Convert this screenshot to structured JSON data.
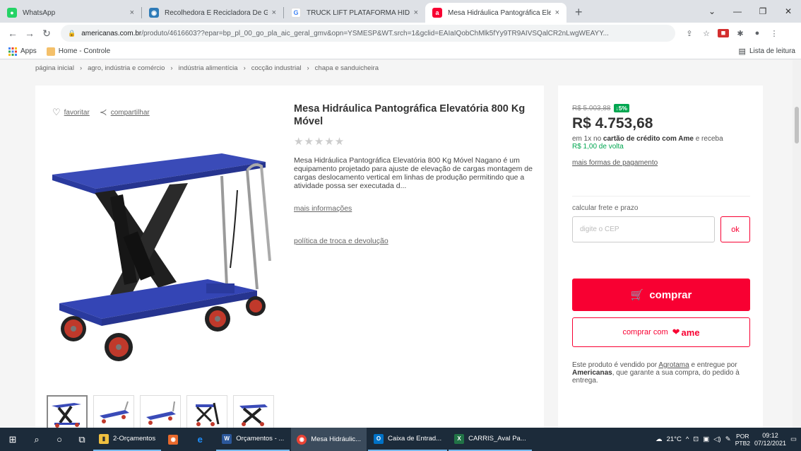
{
  "browser": {
    "tabs": [
      {
        "title": "WhatsApp",
        "color": "#25d366",
        "glyph": "●",
        "active": false
      },
      {
        "title": "Recolhedora E Recicladora De Ga",
        "color": "#2e7bb8",
        "glyph": "◉",
        "active": false
      },
      {
        "title": "TRUCK LIFT PLATAFORMA HIDR/",
        "color": "#4285f4",
        "glyph": "G",
        "active": false
      },
      {
        "title": "Mesa Hidráulica Pantográfica Ele",
        "color": "#f80032",
        "glyph": "a",
        "active": true
      }
    ],
    "new_tab": "+",
    "url_host": "americanas.com.br",
    "url_path": "/produto/4616603??epar=bp_pl_00_go_pla_aic_geral_gmv&opn=YSMESP&WT.srch=1&gclid=EAIaIQobChMlk5fYy9TR9AIVSQalCR2nLwgWEAYY...",
    "bookmarks": [
      {
        "label": "Apps"
      },
      {
        "label": "Home - Controle"
      }
    ],
    "reading_list": "Lista de leitura"
  },
  "page": {
    "breadcrumb": [
      "página inicial",
      "agro, indústria e comércio",
      "indústria alimentícia",
      "cocção industrial",
      "chapa e sanduicheira"
    ],
    "favorite_label": "favoritar",
    "share_label": "compartilhar",
    "product_title": "Mesa Hidráulica Pantográfica Elevatória 800 Kg Móvel",
    "rating_stars": "★★★★★",
    "description": "Mesa Hidráulica Pantográfica Elevatória 800 Kg Móvel Nagano é um equipamento projetado para ajuste de elevação de cargas montagem de cargas deslocamento vertical em linhas de produção permitindo que a atividade possa ser executada d...",
    "more_info": "mais informações",
    "return_policy": "política de troca e devolução",
    "old_price": "R$ 5.003,88",
    "discount": "↓5%",
    "price": "R$ 4.753,68",
    "installment_prefix": "em 1x no",
    "installment_bold": "cartão de crédito com Ame",
    "installment_suffix": "e receba",
    "cashback": "R$ 1,00 de volta",
    "more_payment": "mais formas de pagamento",
    "shipping_label": "calcular frete e prazo",
    "cep_placeholder": "digite o CEP",
    "ok_label": "ok",
    "buy_label": "comprar",
    "ame_label": "comprar com",
    "ame_brand": "ame",
    "seller_prefix": "Este produto é vendido por",
    "seller_name": "Agrotama",
    "seller_mid": "e entregue por",
    "seller_bold": "Americanas",
    "seller_suffix": ", que garante a sua compra, do pedido à entrega."
  },
  "taskbar": {
    "apps": [
      {
        "label": "2-Orçamentos",
        "color": "#f0c040",
        "glyph": "▮",
        "state": "open"
      },
      {
        "label": "",
        "color": "#e8692c",
        "glyph": "◉",
        "state": ""
      },
      {
        "label": "",
        "color": "#1e90ff",
        "glyph": "e",
        "state": ""
      },
      {
        "label": "Orçamentos - ...",
        "color": "#2b579a",
        "glyph": "W",
        "state": "open"
      },
      {
        "label": "Mesa Hidráulic...",
        "color": "#e94335",
        "glyph": "◉",
        "state": "active"
      },
      {
        "label": "Caixa de Entrad...",
        "color": "#0072c6",
        "glyph": "O",
        "state": "open"
      },
      {
        "label": "CARRIS_Aval Pa...",
        "color": "#217346",
        "glyph": "X",
        "state": "open"
      }
    ],
    "weather": "21°C",
    "lang": "POR",
    "lang2": "PTB2",
    "time": "09:12",
    "date": "07/12/2021"
  },
  "colors": {
    "brand": "#f80032",
    "discount": "#00a650",
    "lift_blue": "#2f3faa"
  }
}
